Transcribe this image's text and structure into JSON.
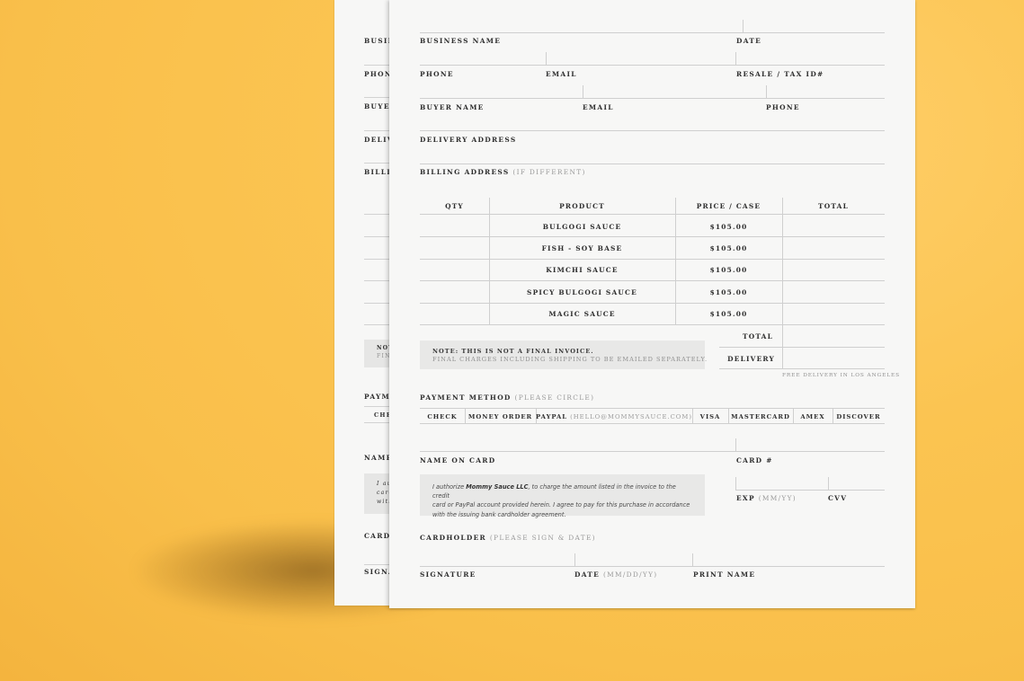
{
  "back_sheet": {
    "labels": [
      "BUSIN",
      "PHONE",
      "BUYER",
      "DELIV",
      "BILLIN",
      "NOTE",
      "FINA",
      "PAYME",
      "CHE",
      "NAME",
      "I auth",
      "card",
      "with",
      "CARD",
      "SIGNA"
    ]
  },
  "form": {
    "business_name": "BUSINESS NAME",
    "date": "DATE",
    "phone": "PHONE",
    "email": "EMAIL",
    "resale_tax_id": "RESALE / TAX ID#",
    "buyer_name": "BUYER NAME",
    "buyer_email": "EMAIL",
    "buyer_phone": "PHONE",
    "delivery_address": "DELIVERY ADDRESS",
    "billing_address": "BILLING ADDRESS",
    "billing_address_note": "(IF DIFFERENT)"
  },
  "order_table": {
    "headers": [
      "QTY",
      "PRODUCT",
      "PRICE / CASE",
      "TOTAL"
    ],
    "rows": [
      {
        "product": "BULGOGI SAUCE",
        "price": "$105.00"
      },
      {
        "product": "FISH - SOY BASE",
        "price": "$105.00"
      },
      {
        "product": "KIMCHI SAUCE",
        "price": "$105.00"
      },
      {
        "product": "SPICY BULGOGI SAUCE",
        "price": "$105.00"
      },
      {
        "product": "MAGIC SAUCE",
        "price": "$105.00"
      }
    ],
    "total_label": "TOTAL",
    "delivery_label": "DELIVERY",
    "free_delivery": "FREE DELIVERY IN LOS ANGELES"
  },
  "note": {
    "line1": "NOTE: THIS IS NOT A FINAL INVOICE.",
    "line2": "FINAL CHARGES INCLUDING SHIPPING TO BE EMAILED SEPARATELY."
  },
  "payment": {
    "title": "PAYMENT METHOD",
    "title_note": "(PLEASE CIRCLE)",
    "options": {
      "check": "CHECK",
      "money_order": "MONEY ORDER",
      "paypal": "PAYPAL",
      "paypal_email": "(HELLO@MOMMYSAUCE.COM)",
      "visa": "VISA",
      "mastercard": "MASTERCARD",
      "amex": "AMEX",
      "discover": "DISCOVER"
    }
  },
  "card": {
    "name_on_card": "NAME ON CARD",
    "card_number": "CARD #",
    "exp": "EXP",
    "exp_format": "(MM/YY)",
    "cvv": "CVV",
    "auth_pre": "I authorize ",
    "auth_company": "Mommy Sauce LLC",
    "auth_line1_rest": ", to charge the amount listed in the invoice to the credit",
    "auth_line2": "card or PayPal account provided herein. I agree to pay for this purchase in accordance",
    "auth_line3": "with the issuing bank cardholder agreement."
  },
  "signature": {
    "title": "CARDHOLDER",
    "title_note": "(PLEASE SIGN & DATE)",
    "signature": "SIGNATURE",
    "date": "DATE",
    "date_format": "(MM/DD/YY)",
    "print_name": "PRINT NAME"
  }
}
